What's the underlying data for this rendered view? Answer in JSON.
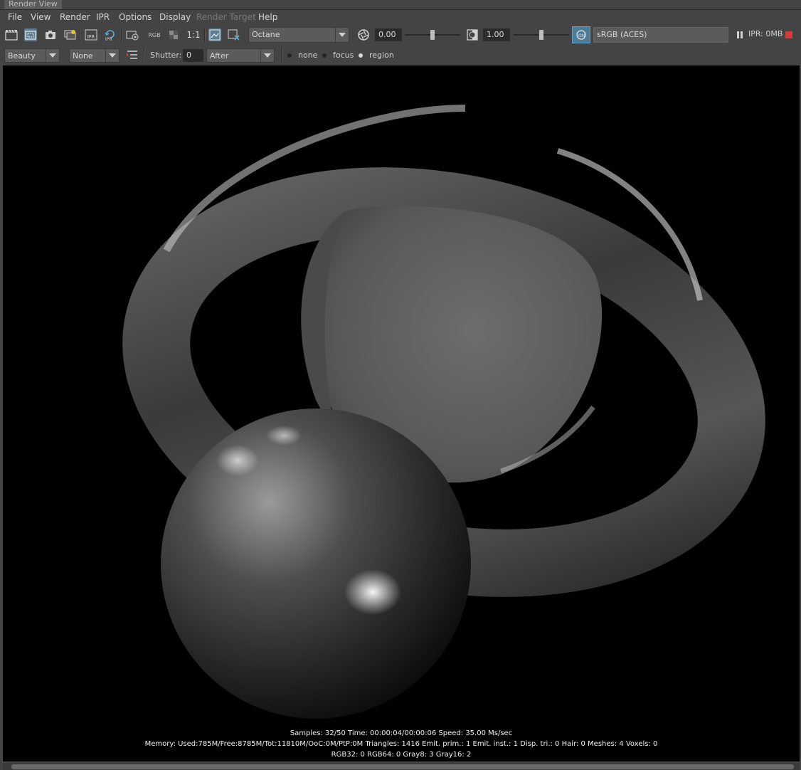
{
  "window": {
    "title": "Render View"
  },
  "menu": [
    "File",
    "View",
    "Render",
    "IPR",
    "Options",
    "Display",
    "Render Target",
    "Help"
  ],
  "toolbar1": {
    "rgb_label": "RGB",
    "ratio_label": "1:1",
    "renderer": "Octane",
    "exposure_value": "0.00",
    "exposure_level": 0.5,
    "gamma_value": "1.00",
    "gamma_level": 0.5,
    "color_space": "sRGB (ACES)",
    "ipr_memory": "IPR: 0MB",
    "icons": [
      "render-frame-icon",
      "render-region-icon",
      "snapshot-icon",
      "render-sequence-icon",
      "ipr-render-icon",
      "refresh-ipr-icon",
      "render-settings-icon",
      "rgb-channels-icon",
      "alpha-channel-icon",
      "real-size-icon",
      "keep-image-icon",
      "remove-image-icon",
      "exposure-icon",
      "gamma-icon",
      "color-management-icon",
      "pause-icon",
      "stop-icon"
    ],
    "colors": {
      "stop": "#d63c3c",
      "active": "#5c7d92"
    }
  },
  "toolbar2": {
    "pass": "Beauty",
    "aov": "None",
    "shutter_label": "Shutter:",
    "shutter_value": "0",
    "motion": "After",
    "focus_options": [
      {
        "label": "none",
        "selected": false
      },
      {
        "label": "focus",
        "selected": false
      },
      {
        "label": "region",
        "selected": true
      }
    ]
  },
  "stats": {
    "line1": "Samples: 32/50 Time: 00:00:04/00:00:06 Speed: 35.00 Ms/sec",
    "line2": "Memory: Used:785M/Free:8785M/Tot:11810M/OoC:0M/PtP:0M Triangles: 1416 Emit. prim.: 1 Emit. inst.: 1 Disp. tri.: 0 Hair: 0 Meshes: 4 Voxels: 0",
    "line3": "RGB32: 0 RGB64: 0 Gray8: 3 Gray16: 2"
  }
}
